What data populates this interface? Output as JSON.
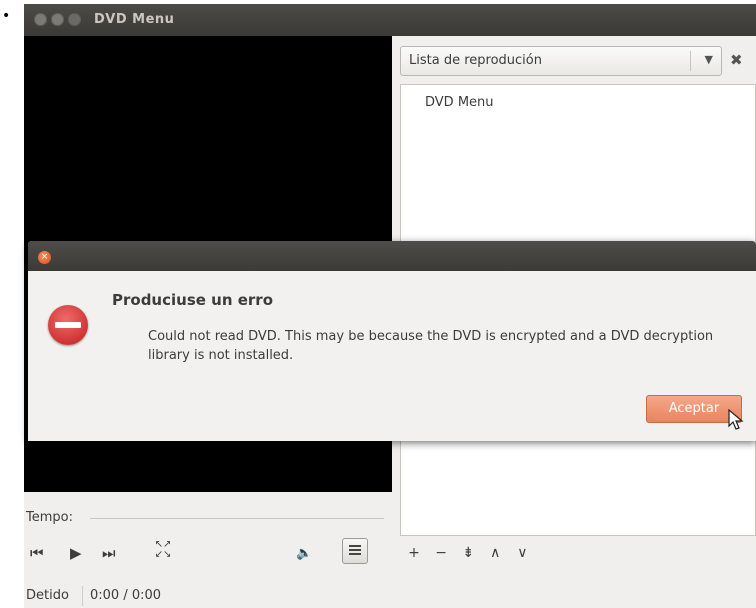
{
  "window": {
    "title": "DVD Menu"
  },
  "playlist": {
    "selector_label": "Lista de reprodución",
    "items": [
      {
        "label": "DVD Menu"
      }
    ],
    "tools": [
      "+",
      "−",
      "⇟",
      "∧",
      "∨"
    ]
  },
  "controls": {
    "tempo_label": "Tempo:",
    "status": "Detido",
    "time": "0:00 / 0:00"
  },
  "dialog": {
    "heading": "Produciuse un erro",
    "message": "Could not read DVD. This may be because the DVD is encrypted and a DVD decryption library is not installed.",
    "button": "Aceptar"
  },
  "icons": {
    "prev": "previous-icon",
    "play": "play-icon",
    "next": "next-icon",
    "fullscreen": "fullscreen-icon",
    "volume": "volume-muted-icon",
    "playlist_toggle": "playlist-icon",
    "error": "error-icon"
  },
  "colors": {
    "titlebar": "#3f3e3a",
    "accent_button": "#e8845d",
    "error_icon": "#c21d1d"
  }
}
